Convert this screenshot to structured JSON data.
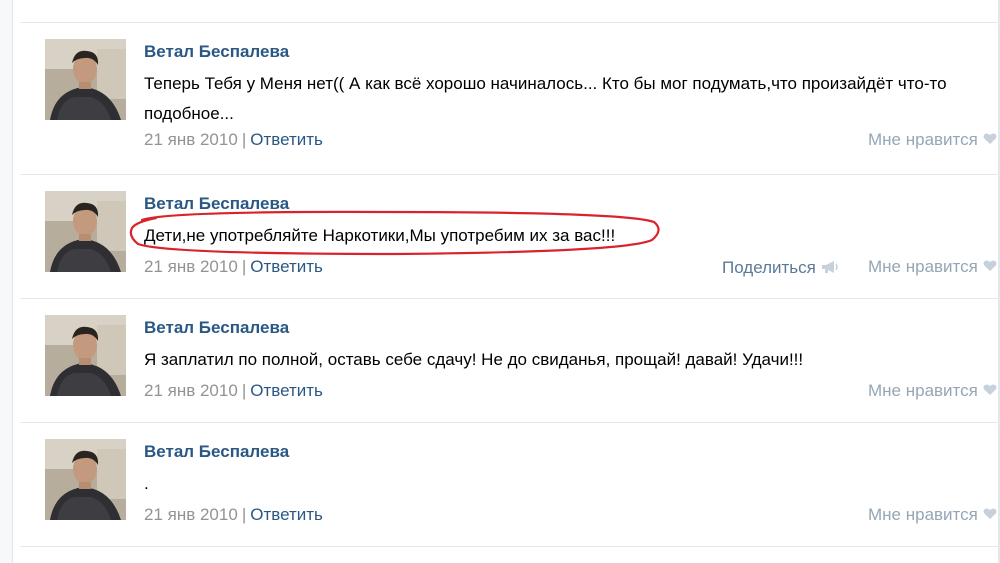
{
  "posts": [
    {
      "author": "Ветал Беспалева",
      "text": "Теперь Тебя у Меня нет(( А как всё хорошо начиналось... Кто бы мог подумать,что произайдёт что-то подобное...",
      "date": "21 янв 2010",
      "separator": "|",
      "reply": "Ответить",
      "like": "Мне нравится"
    },
    {
      "author": "Ветал Беспалева",
      "text": "Дети,не употребляйте Наркотики,Мы употребим их за вас!!!",
      "date": "21 янв 2010",
      "separator": "|",
      "reply": "Ответить",
      "share": "Поделиться",
      "like": "Мне нравится"
    },
    {
      "author": "Ветал Беспалева",
      "text": "Я заплатил по полной, оставь себе сдачу! Не до свиданья, прощай! давай! Удачи!!!",
      "date": "21 янв 2010",
      "separator": "|",
      "reply": "Ответить",
      "like": "Мне нравится"
    },
    {
      "author": "Ветал Беспалева",
      "text": ".",
      "date": "21 янв 2010",
      "separator": "|",
      "reply": "Ответить",
      "like": "Мне нравится"
    }
  ],
  "icons": {
    "like": "heart-icon",
    "share": "megaphone-icon"
  },
  "colors": {
    "author": "#2a5885",
    "reply": "#2a5885",
    "meta": "#939393",
    "like": "#95a6b6",
    "share": "#5b7a99",
    "highlight": "#d9232a"
  }
}
